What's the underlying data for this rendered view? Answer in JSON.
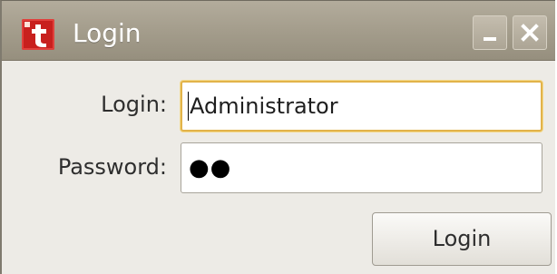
{
  "window": {
    "title": "Login",
    "icon": "red-t-app-icon",
    "controls": {
      "minimize": "minimize-icon",
      "close": "close-icon"
    }
  },
  "form": {
    "login_label": "Login:",
    "login_value": "Administrator",
    "password_label": "Password:",
    "password_value": "●●",
    "submit_label": "Login"
  },
  "colors": {
    "titlebar": "#a49d8c",
    "focus_border": "#e2b34a",
    "icon_red": "#c8201e"
  }
}
